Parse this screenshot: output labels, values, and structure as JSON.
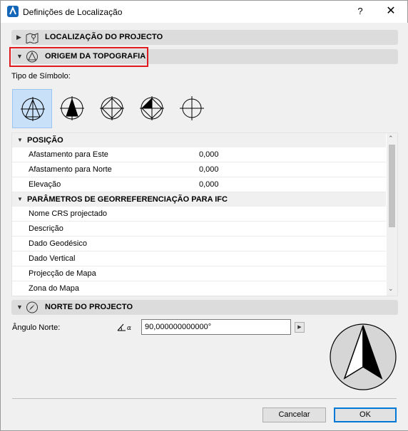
{
  "window": {
    "title": "Definições de Localização",
    "help_label": "?",
    "close_label": "✕"
  },
  "sections": {
    "location": {
      "title": "LOCALIZAÇÃO DO PROJECTO",
      "arrow": "▶",
      "icon": "map-pin-icon"
    },
    "origin": {
      "title": "ORIGEM DA TOPOGRAFIA",
      "arrow": "▼",
      "icon": "survey-point-icon",
      "highlighted": true,
      "highlight_color": "#e0191e"
    },
    "north": {
      "title": "NORTE DO PROJECTO",
      "arrow": "▼",
      "icon": "compass-icon"
    }
  },
  "symbol_type": {
    "label": "Tipo de Símbolo:",
    "selected_index": 0,
    "options": [
      "symbol-triangle-outline",
      "symbol-triangle-filled",
      "symbol-diamond-outline",
      "symbol-diamond-half-filled",
      "symbol-crosshair"
    ]
  },
  "properties": {
    "position_header": "POSIÇÃO",
    "position_rows": [
      {
        "label": "Afastamento para Este",
        "value": "0,000"
      },
      {
        "label": "Afastamento para Norte",
        "value": "0,000"
      },
      {
        "label": "Elevação",
        "value": "0,000"
      }
    ],
    "ifc_header": "PARÂMETROS DE GEORREFERENCIAÇÃO PARA IFC",
    "ifc_rows": [
      {
        "label": "Nome CRS projectado",
        "value": ""
      },
      {
        "label": "Descrição",
        "value": ""
      },
      {
        "label": "Dado Geodésico",
        "value": ""
      },
      {
        "label": "Dado Vertical",
        "value": ""
      },
      {
        "label": "Projecção de Mapa",
        "value": ""
      },
      {
        "label": "Zona do Mapa",
        "value": ""
      }
    ],
    "scroll_position": 0.0
  },
  "north": {
    "angle_label": "Ângulo Norte:",
    "angle_icon_text": "∠α",
    "angle_value": "90,000000000000°",
    "spin_label": "▶"
  },
  "buttons": {
    "cancel": "Cancelar",
    "ok": "OK"
  },
  "colors": {
    "selected_symbol_bg": "#c8e0f8",
    "section_bar": "#dcdcdc",
    "ok_border": "#0078d7"
  }
}
